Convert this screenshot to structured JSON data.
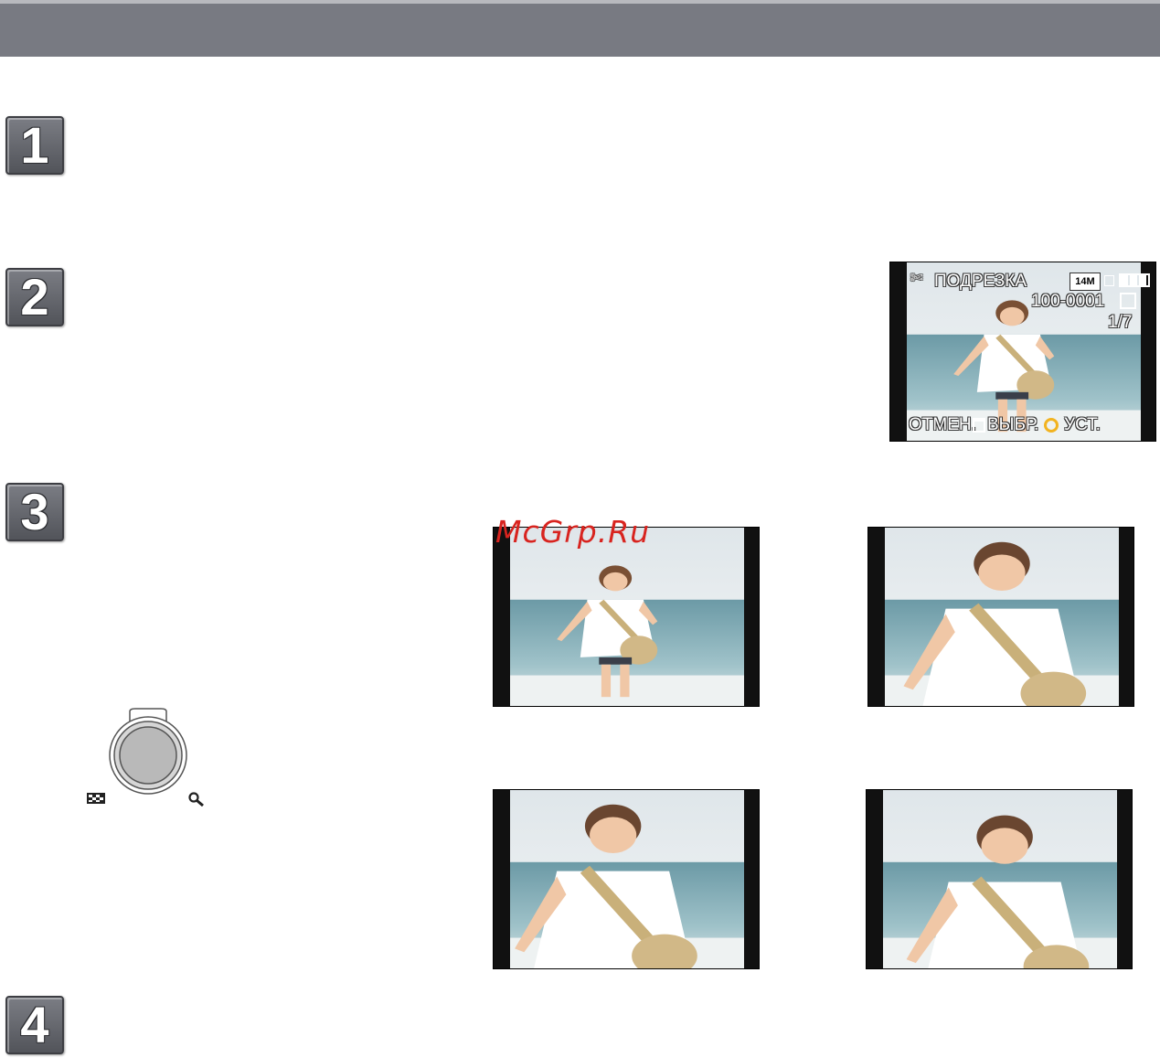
{
  "steps": [
    "1",
    "2",
    "3",
    "4"
  ],
  "lcd": {
    "mode_label": "ПОДРЕЗКА",
    "size_badge": "14M",
    "file_number": "100-0001",
    "counter": "1/7",
    "cancel_label": "ОТМЕН.",
    "select_label": "ВЫБР.",
    "set_label": "УСТ."
  },
  "watermark": "McGrp.Ru",
  "icons": {
    "scissors": "scissors-icon",
    "battery": "battery-icon",
    "protect": "protect-icon",
    "trash": "trash-icon",
    "dial": "rear-dial-icon",
    "wide": "wide-zoom-icon",
    "tele": "tele-zoom-icon"
  }
}
